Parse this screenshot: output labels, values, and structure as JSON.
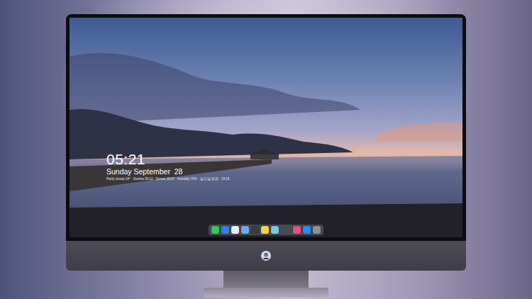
{
  "screen": {
    "clock": "05:21",
    "date": "Sunday September  28",
    "info": "Partly cloudy 24° · Sunrise 06:12 · Sunset 18:07 · Humidity 75% · 일요일 맑음 · 19:15"
  },
  "dock": {
    "items": [
      {
        "color": "#34c759"
      },
      {
        "color": "#2f7ff0"
      },
      {
        "color": "#e9eef5"
      },
      {
        "color": "#6fa8e8"
      },
      {
        "color": "#3a3a44"
      },
      {
        "color": "#f5d547"
      },
      {
        "color": "#7dc8e8"
      },
      {
        "color": "#f04f7c"
      },
      {
        "color": "#1f8ff5"
      },
      {
        "color": "#8e8e96"
      }
    ]
  }
}
